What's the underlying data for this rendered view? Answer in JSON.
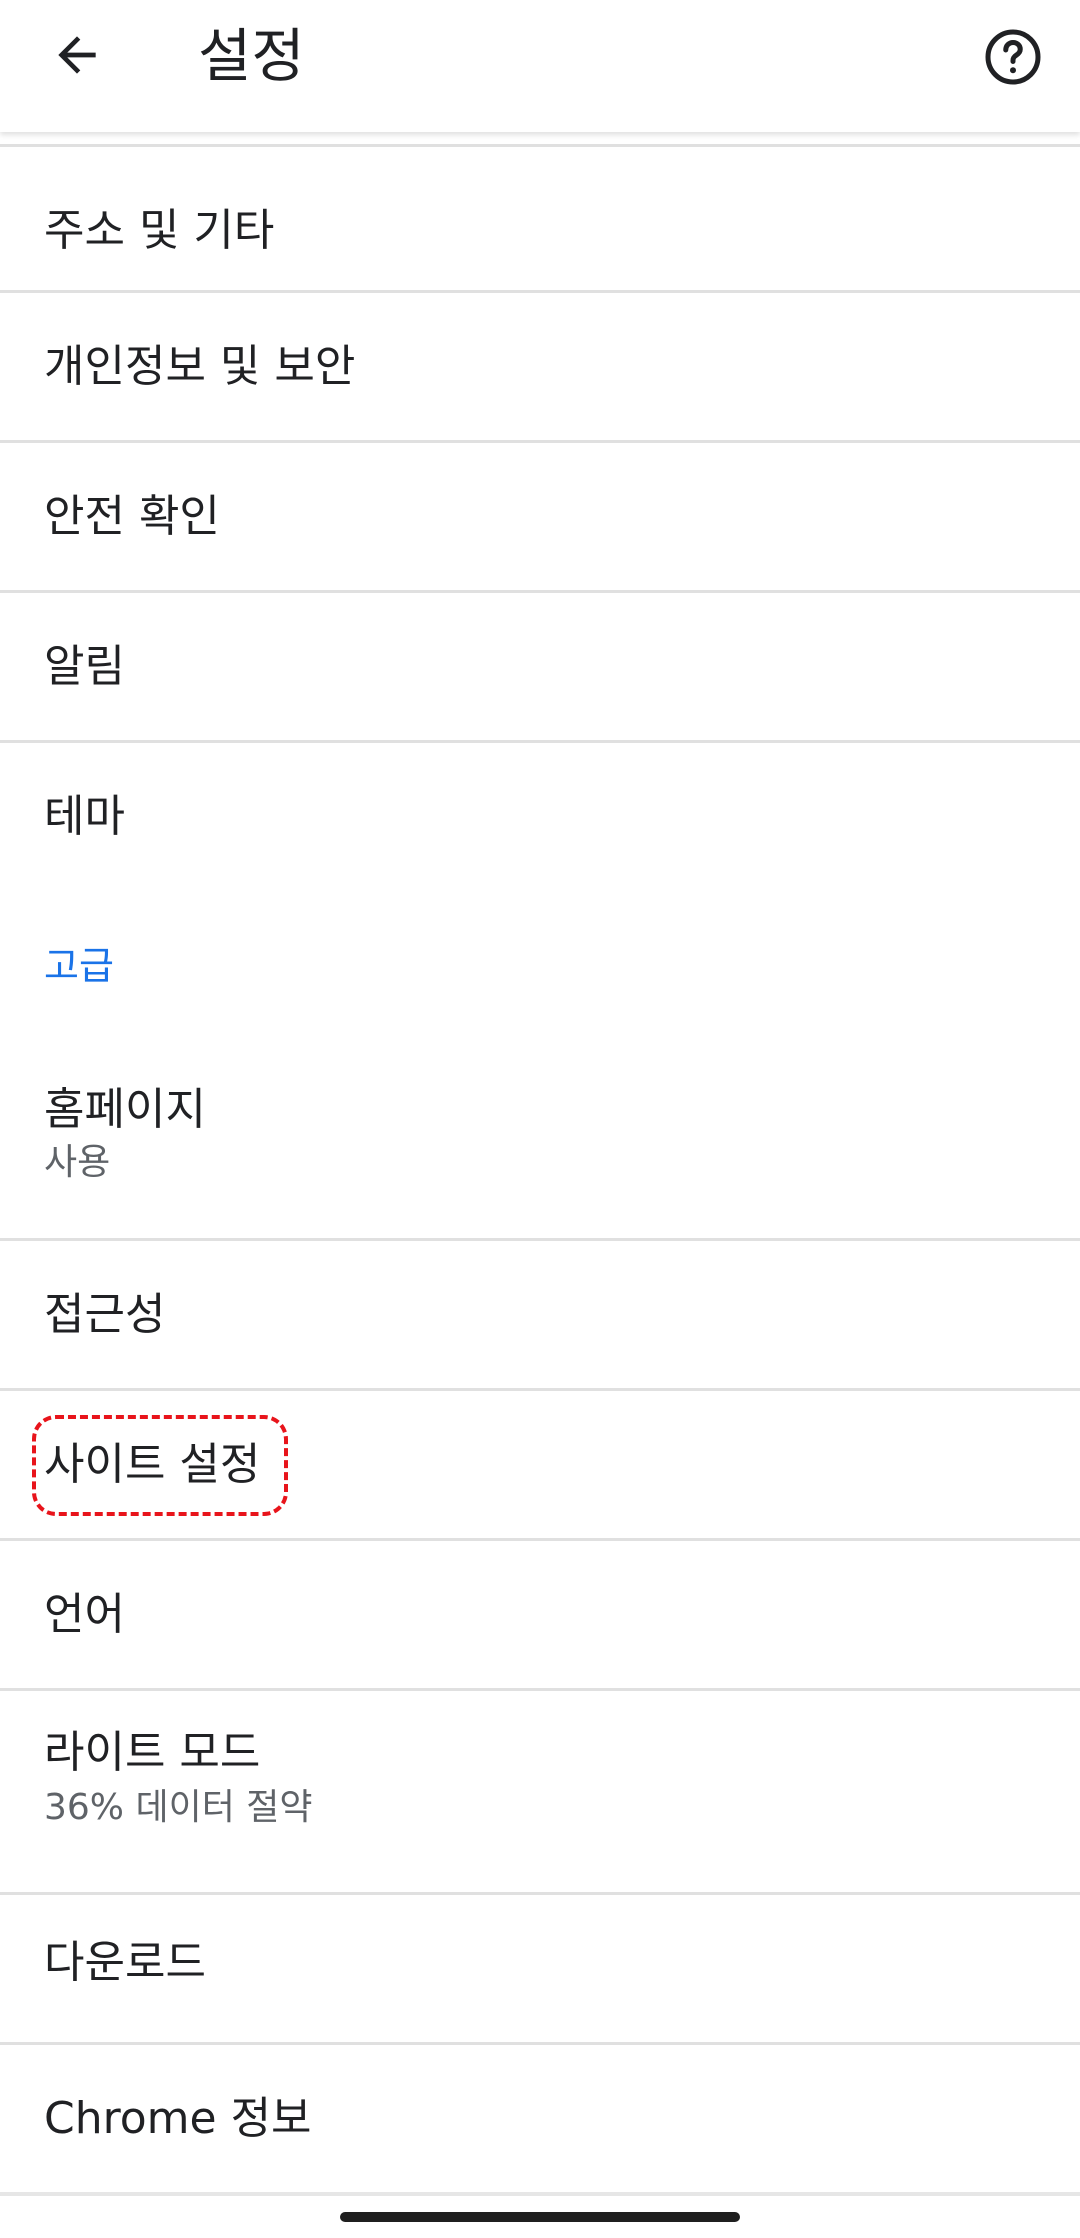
{
  "header": {
    "title": "설정",
    "back_icon": "arrow-back-icon",
    "help_icon": "help-circle-icon"
  },
  "items": [
    {
      "label": "주소 및 기타"
    },
    {
      "label": "개인정보 및 보안"
    },
    {
      "label": "안전 확인"
    },
    {
      "label": "알림"
    },
    {
      "label": "테마"
    },
    {
      "label": "홈페이지",
      "summary": "사용"
    },
    {
      "label": "접근성"
    },
    {
      "label": "사이트 설정"
    },
    {
      "label": "언어"
    },
    {
      "label": "라이트 모드",
      "summary": "36% 데이터 절약"
    },
    {
      "label": "다운로드"
    },
    {
      "label": "Chrome 정보"
    }
  ],
  "section": {
    "advanced_label": "고급"
  },
  "colors": {
    "accent": "#1a73e8",
    "highlight": "#e8141b",
    "divider": "#e0e0e0",
    "text_primary": "#202124",
    "text_secondary": "#5f6368"
  }
}
